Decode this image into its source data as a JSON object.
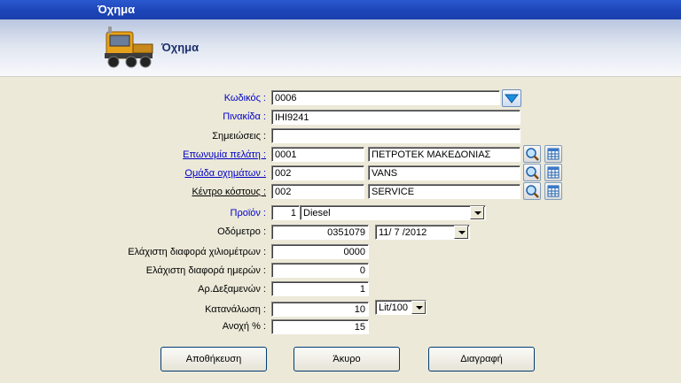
{
  "window": {
    "title": "Όχημα"
  },
  "header": {
    "title": "Όχημα",
    "icon": "truck-icon"
  },
  "form": {
    "code": {
      "label": "Κωδικός :",
      "value": "0006"
    },
    "plate": {
      "label": "Πινακίδα :",
      "value": "ΙΗΙ9241"
    },
    "notes": {
      "label": "Σημειώσεις :",
      "value": ""
    },
    "customer": {
      "label": "Επωνυμία πελάτη :",
      "code": "0001",
      "name": "ΠΕΤΡΟΤΕΚ ΜΑΚΕΔΟΝΙΑΣ"
    },
    "vehicle_group": {
      "label": "Ομάδα οχημάτων :",
      "code": "002",
      "name": "VANS"
    },
    "cost_center": {
      "label": "Κέντρο κόστους :",
      "code": "002",
      "name": "SERVICE"
    },
    "product": {
      "label": "Προϊόν :",
      "code": "1",
      "name": "Diesel"
    },
    "odometer": {
      "label": "Οδόμετρο :",
      "value": "0351079",
      "date": "11/ 7 /2012"
    },
    "min_km_diff": {
      "label": "Ελάχιστη διαφορά χιλιομέτρων :",
      "value": "0000"
    },
    "min_day_diff": {
      "label": "Ελάχιστη διαφορά ημερών :",
      "value": "0"
    },
    "tanks": {
      "label": "Αρ.Δεξαμενών :",
      "value": "1"
    },
    "consumption": {
      "label": "Κατανάλωση :",
      "value": "10",
      "unit": "Lit/100"
    },
    "tolerance": {
      "label": "Ανοχή % :",
      "value": "15"
    }
  },
  "buttons": {
    "save": "Αποθήκευση",
    "cancel": "Άκυρο",
    "delete": "Διαγραφή"
  },
  "colors": {
    "titlebar": "#1d45b8",
    "label_blue": "#0000c8",
    "background": "#ECE9D8"
  }
}
